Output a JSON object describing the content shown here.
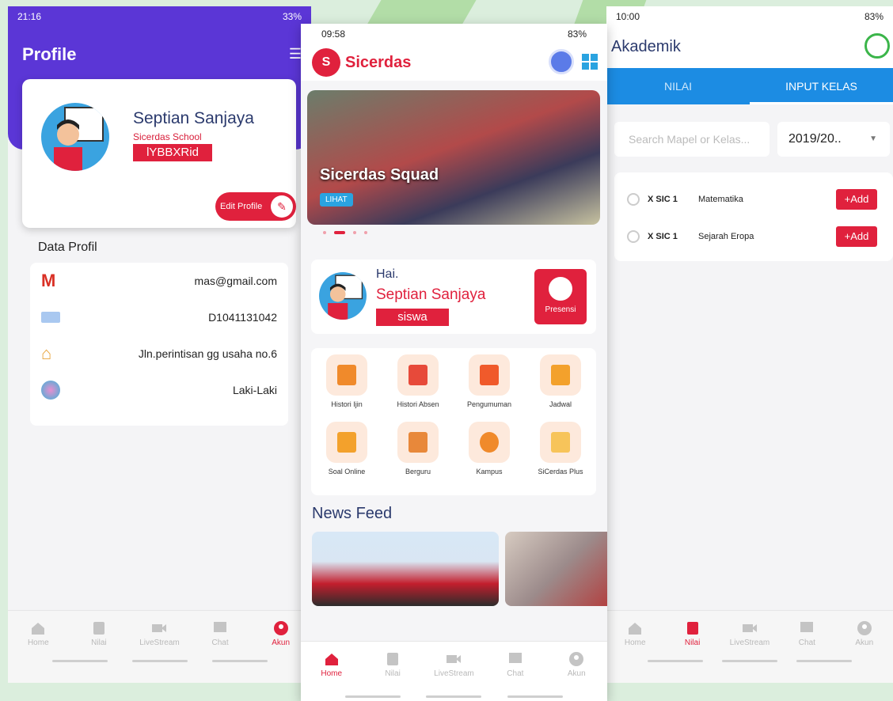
{
  "screen1": {
    "status_time": "21:16",
    "status_battery": "33%",
    "page_title": "Profile",
    "name": "Septian Sanjaya",
    "school": "Sicerdas School",
    "code": "lYBBXRid",
    "edit_label": "Edit Profile",
    "data_title": "Data Profil",
    "fields": {
      "email": "mas@gmail.com",
      "id": "D1041131042",
      "address": "Jln.perintisan gg usaha no.6",
      "gender": "Laki-Laki"
    },
    "nav": [
      "Home",
      "Nilai",
      "LiveStream",
      "Chat",
      "Akun"
    ],
    "active_nav": "Akun"
  },
  "screen2": {
    "status_time": "09:58",
    "status_battery": "83%",
    "app_title": "Sicerdas",
    "banner_title": "Sicerdas Squad",
    "banner_button": "LIHAT",
    "greeting": "Hai.",
    "name": "Septian Sanjaya",
    "role": "siswa",
    "presensi_label": "Presensi",
    "menu": [
      "Histori Ijin",
      "Histori Absen",
      "Pengumuman",
      "Jadwal",
      "Soal Online",
      "Berguru",
      "Kampus",
      "SiCerdas Plus"
    ],
    "news_title": "News Feed",
    "nav": [
      "Home",
      "Nilai",
      "LiveStream",
      "Chat",
      "Akun"
    ],
    "active_nav": "Home"
  },
  "screen3": {
    "status_time": "10:00",
    "status_battery": "83%",
    "page_title": "Akademik",
    "tabs": [
      "NILAI",
      "INPUT KELAS"
    ],
    "search_placeholder": "Search Mapel or Kelas...",
    "year": "2019/20..",
    "rows": [
      {
        "kelas": "X SIC 1",
        "mapel": "Matematika",
        "action": "+Add"
      },
      {
        "kelas": "X SIC 1",
        "mapel": "Sejarah Eropa",
        "action": "+Add"
      }
    ],
    "nav": [
      "Home",
      "Nilai",
      "LiveStream",
      "Chat",
      "Akun"
    ],
    "active_nav": "Nilai"
  },
  "colors": {
    "primary_red": "#e0213d",
    "purple": "#5b36d6",
    "blue": "#1c8ce3"
  }
}
